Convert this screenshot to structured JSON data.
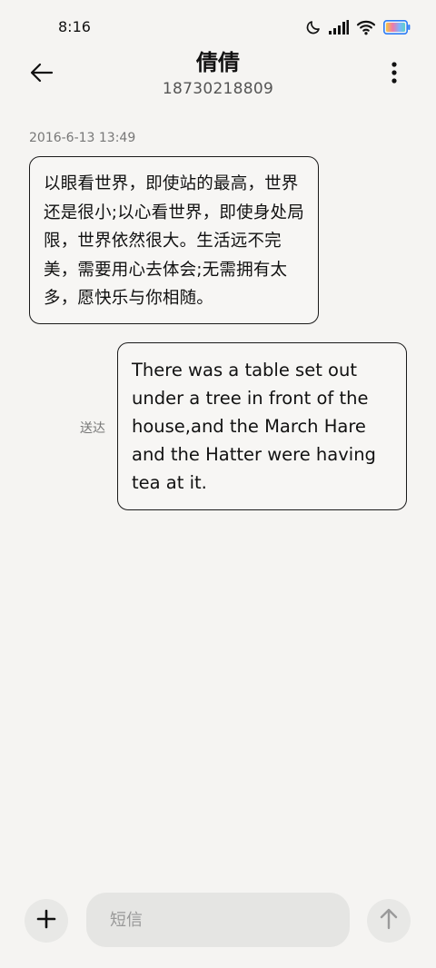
{
  "status_bar": {
    "time": "8:16",
    "icons": [
      "moon-icon",
      "signal-icon",
      "wifi-icon",
      "battery-icon"
    ]
  },
  "header": {
    "back_icon": "arrow-left-icon",
    "contact_name": "倩倩",
    "contact_number": "18730218809",
    "more_icon": "more-vertical-icon"
  },
  "conversation": {
    "timestamp": "2016-6-13 13:49",
    "messages": [
      {
        "direction": "incoming",
        "text": "以眼看世界，即使站的最高，世界还是很小;以心看世界，即使身处局限，世界依然很大。生活远不完美，需要用心去体会;无需拥有太多，愿快乐与你相随。"
      },
      {
        "direction": "outgoing",
        "text": "There was a table set out under a tree in front of the house,and the March Hare and the Hatter were having tea at it.",
        "status": "送达"
      }
    ]
  },
  "input_bar": {
    "add_icon": "plus-icon",
    "placeholder": "短信",
    "value": "",
    "send_icon": "arrow-up-icon"
  },
  "colors": {
    "background": "#f5f4f2",
    "bubble_border": "#1a1a1a",
    "muted_text": "#777777",
    "input_background": "#e5e5e3"
  }
}
